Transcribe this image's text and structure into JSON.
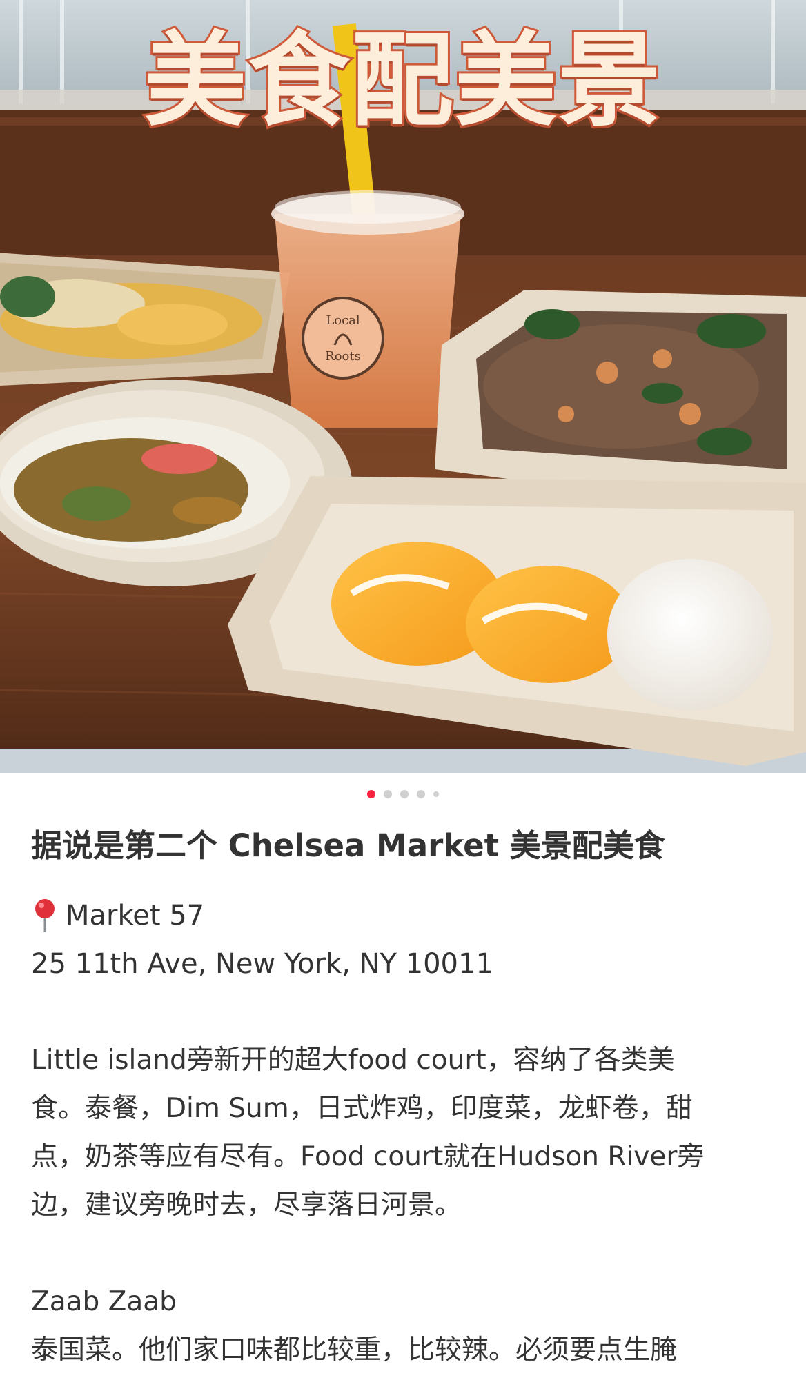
{
  "hero": {
    "overlay_title": "美食配美景",
    "cup_logo_text": "Local Roots"
  },
  "carousel": {
    "total": 5,
    "active_index": 0
  },
  "post": {
    "title": "据说是第二个 Chelsea Market 美景配美食",
    "location_name": "Market 57",
    "address": "25 11th Ave, New York, NY 10011",
    "paragraph_1_line_1": "Little island旁新开的超大food court，容纳了各类美",
    "paragraph_1_line_2": "食。泰餐，Dim Sum，日式炸鸡，印度菜，龙虾卷，甜",
    "paragraph_1_line_3": "点，奶茶等应有尽有。Food court就在Hudson River旁",
    "paragraph_1_line_4": "边，建议旁晚时去，尽享落日河景。",
    "section_2_title": "Zaab Zaab",
    "section_2_line_1": "泰国菜。他们家口味都比较重，比较辣。必须要点生腌"
  },
  "colors": {
    "accent": "#ff2442",
    "title_fill": "#fdeedb",
    "title_stroke": "#cf5a3a"
  },
  "icons": {
    "location": "red-pin-icon"
  }
}
